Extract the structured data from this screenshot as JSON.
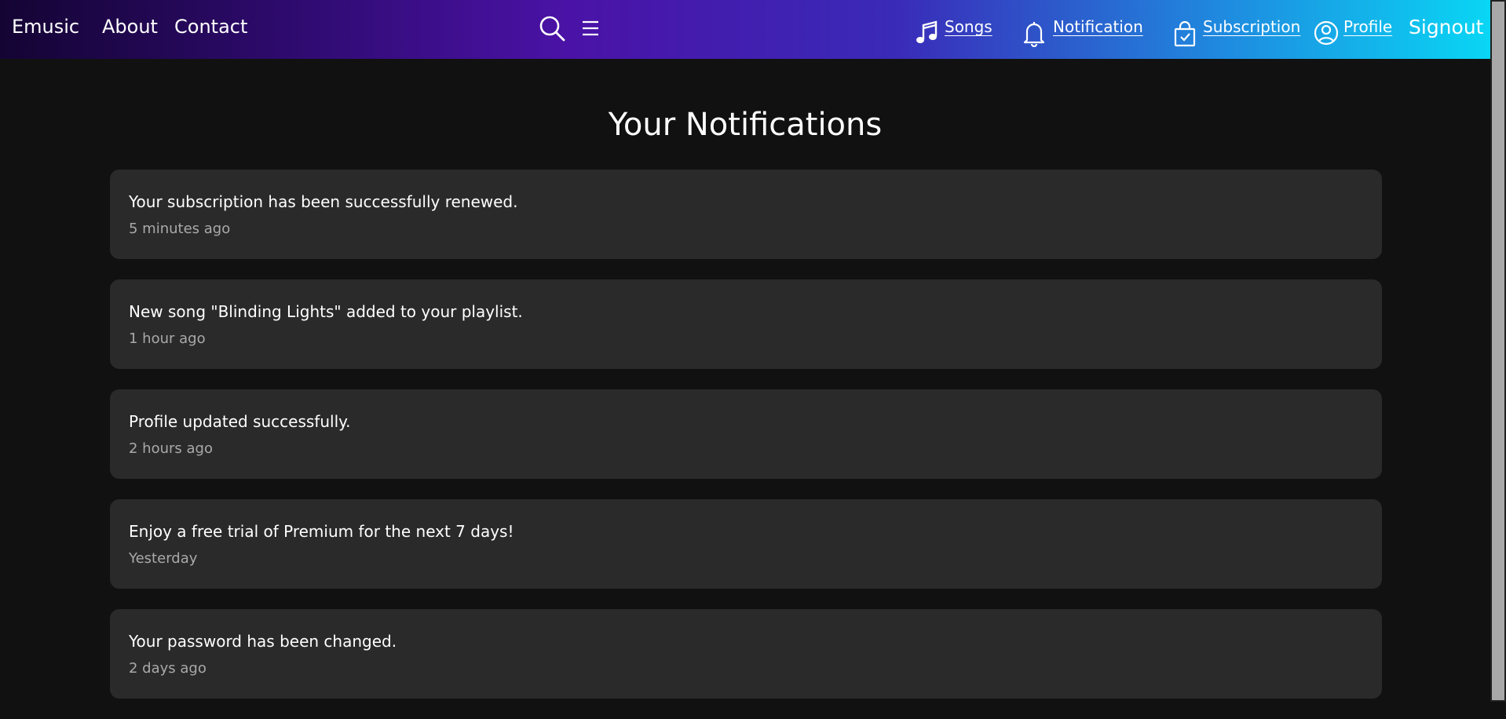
{
  "nav": {
    "brand": "Emusic",
    "about": "About",
    "contact": "Contact",
    "search_icon": "search-icon",
    "menu_icon": "hamburger-menu-icon",
    "songs": "Songs",
    "notification": "Notification",
    "subscription": "Subscription",
    "profile": "Profile",
    "signout": "Signout",
    "colors": {
      "gradient_start": "#140433",
      "gradient_mid": "#4a12a6",
      "gradient_end": "#09d6f4"
    }
  },
  "main": {
    "title": "Your Notifications",
    "notifications": [
      {
        "message": "Your subscription has been successfully renewed.",
        "time": "5 minutes ago"
      },
      {
        "message": "New song \"Blinding Lights\" added to your playlist.",
        "time": "1 hour ago"
      },
      {
        "message": "Profile updated successfully.",
        "time": "2 hours ago"
      },
      {
        "message": "Enjoy a free trial of Premium for the next 7 days!",
        "time": "Yesterday"
      },
      {
        "message": "Your password has been changed.",
        "time": "2 days ago"
      }
    ]
  },
  "colors": {
    "background": "#111111",
    "card": "#2a2a2a",
    "time_text": "#a9a9a9"
  }
}
